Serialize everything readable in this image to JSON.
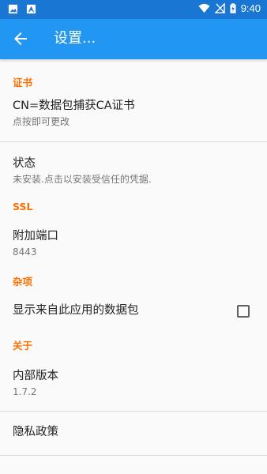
{
  "statusbar": {
    "left_icons": [
      "image-notification-icon",
      "a-notification-icon"
    ],
    "time": "9:40"
  },
  "appbar": {
    "title": "设置..."
  },
  "sections": {
    "cert": {
      "header": "证书",
      "items": [
        {
          "title": "CN=数据包捕获CA证书",
          "summary": "点按即可更改"
        },
        {
          "title": "状态",
          "summary": "未安装.点击以安装受信任的凭据."
        }
      ]
    },
    "ssl": {
      "header": "SSL",
      "items": [
        {
          "title": "附加端口",
          "summary": "8443"
        }
      ]
    },
    "misc": {
      "header": "杂项",
      "items": [
        {
          "title": "显示来自此应用的数据包",
          "checked": false
        }
      ]
    },
    "about": {
      "header": "关于",
      "items": [
        {
          "title": "内部版本",
          "summary": "1.7.2"
        },
        {
          "title": "隐私政策"
        }
      ]
    }
  },
  "colors": {
    "statusbar": "#1976d2",
    "appbar": "#2196f3",
    "section_header": "#ff6f00"
  }
}
